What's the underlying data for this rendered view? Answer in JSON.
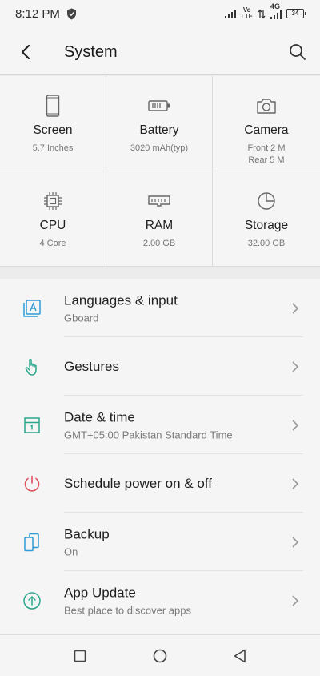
{
  "status_bar": {
    "time": "8:12 PM",
    "volte_line1": "Vo",
    "volte_line2": "LTE",
    "network": "4G",
    "battery": "34"
  },
  "header": {
    "title": "System"
  },
  "specs": [
    {
      "name": "Screen",
      "sub": "5.7 Inches",
      "sub2": "",
      "icon": "phone-icon"
    },
    {
      "name": "Battery",
      "sub": "3020 mAh(typ)",
      "sub2": "",
      "icon": "battery-icon"
    },
    {
      "name": "Camera",
      "sub": "Front 2 M",
      "sub2": "Rear 5 M",
      "icon": "camera-icon"
    },
    {
      "name": "CPU",
      "sub": "4 Core",
      "sub2": "",
      "icon": "cpu-icon"
    },
    {
      "name": "RAM",
      "sub": "2.00 GB",
      "sub2": "",
      "icon": "ram-icon"
    },
    {
      "name": "Storage",
      "sub": "32.00 GB",
      "sub2": "",
      "icon": "pie-chart-icon"
    }
  ],
  "settings": [
    {
      "title": "Languages & input",
      "sub": "Gboard",
      "icon": "language-icon",
      "color": "#2e9bd6"
    },
    {
      "title": "Gestures",
      "sub": "",
      "icon": "gesture-hand-icon",
      "color": "#29a68a"
    },
    {
      "title": "Date & time",
      "sub": "GMT+05:00 Pakistan Standard Time",
      "icon": "calendar-icon",
      "color": "#29a68a"
    },
    {
      "title": "Schedule power on & off",
      "sub": "",
      "icon": "power-icon",
      "color": "#e2505e"
    },
    {
      "title": "Backup",
      "sub": "On",
      "icon": "backup-icon",
      "color": "#2e9bd6"
    },
    {
      "title": "App Update",
      "sub": "Best place to discover apps",
      "icon": "update-arrow-icon",
      "color": "#29a68a"
    }
  ]
}
